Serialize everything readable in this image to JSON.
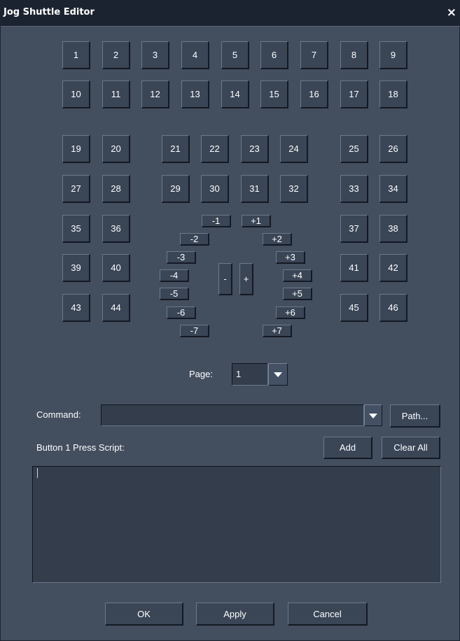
{
  "window": {
    "title": "Jog Shuttle Editor",
    "close_glyph": "×"
  },
  "buttons": [
    "1",
    "2",
    "3",
    "4",
    "5",
    "6",
    "7",
    "8",
    "9",
    "10",
    "11",
    "12",
    "13",
    "14",
    "15",
    "16",
    "17",
    "18",
    "19",
    "20",
    "21",
    "22",
    "23",
    "24",
    "25",
    "26",
    "27",
    "28",
    "29",
    "30",
    "31",
    "32",
    "33",
    "34",
    "35",
    "36",
    "37",
    "38",
    "39",
    "40",
    "41",
    "42",
    "43",
    "44",
    "45",
    "46"
  ],
  "jog": [
    "-1",
    "+1",
    "-2",
    "+2",
    "-3",
    "+3",
    "-4",
    "+4",
    "-5",
    "+5",
    "-6",
    "+6",
    "-7",
    "+7"
  ],
  "shuttle": {
    "minus": "-",
    "plus": "+"
  },
  "page": {
    "label": "Page:",
    "value": "1"
  },
  "command": {
    "label": "Command:",
    "value": "",
    "path_label": "Path..."
  },
  "script": {
    "label": "Button 1 Press Script:",
    "add_label": "Add",
    "clear_label": "Clear All",
    "content": ""
  },
  "footer": {
    "ok_label": "OK",
    "apply_label": "Apply",
    "cancel_label": "Cancel"
  },
  "icons": {
    "close": "close-icon",
    "dropdown": "chevron-down-icon"
  }
}
